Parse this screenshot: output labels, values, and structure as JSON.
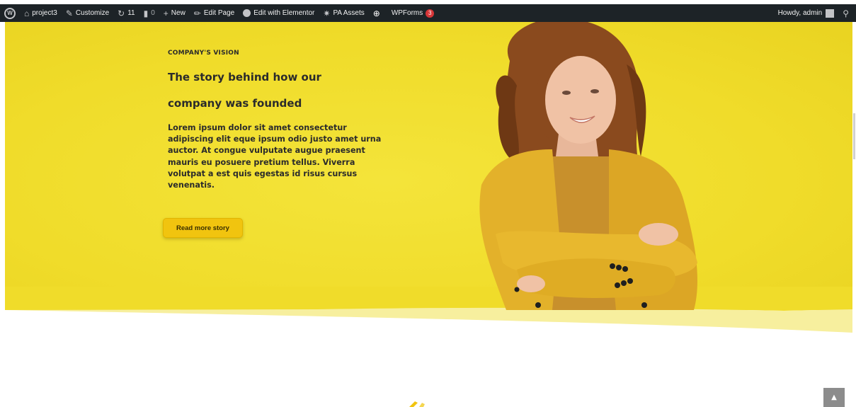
{
  "adminbar": {
    "site_name": "project3",
    "customize": "Customize",
    "updates_count": "11",
    "comments_count": "0",
    "new_label": "New",
    "edit_page": "Edit Page",
    "edit_elementor": "Edit with Elementor",
    "pa_assets": "PA Assets",
    "wpforms": "WPForms",
    "wpforms_badge": "3",
    "howdy": "Howdy, admin"
  },
  "hero": {
    "kicker": "COMPANY'S VISION",
    "title_line1": "The story behind how our",
    "title_line2": "company was founded",
    "body": "Lorem ipsum dolor sit amet consectetur adipiscing elit eque ipsum odio justo amet urna auctor. At congue vulputate augue praesent mauris eu posuere pretium tellus. Viverra volutpat a est quis egestas id risus cursus venenatis.",
    "cta_label": "Read more story"
  },
  "colors": {
    "hero_yellow": "#f0dc2a",
    "adminbar_bg": "#1d2327",
    "button_yellow": "#f1c40f",
    "jacket": "#e3b12a"
  },
  "icons": {
    "wp_logo": "wordpress-icon",
    "dashboard": "dashboard-icon",
    "customize": "brush-icon",
    "updates": "refresh-icon",
    "comments": "comment-icon",
    "new": "plus-icon",
    "edit": "pencil-icon",
    "search": "search-icon",
    "back_to_top": "chevron-up-icon"
  }
}
